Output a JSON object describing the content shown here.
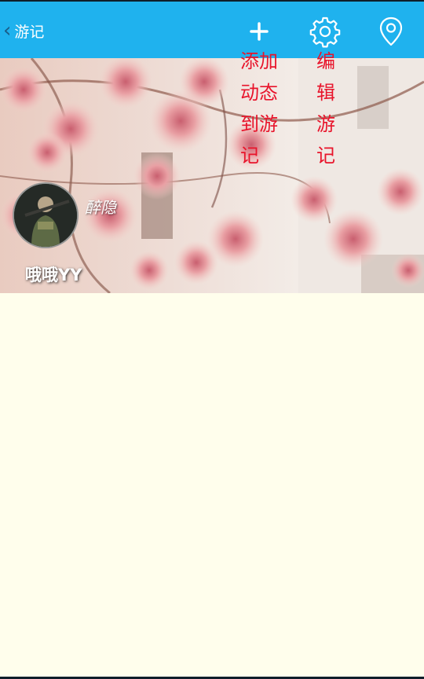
{
  "header": {
    "back_icon": "chevron-left-icon",
    "title": "游记",
    "add_icon": "plus-icon",
    "settings_icon": "gear-icon",
    "location_icon": "map-pin-icon",
    "bar_color": "#1fb2ee"
  },
  "tooltips": {
    "add_text": "添加动态到游记",
    "edit_text": "编辑游记",
    "color": "#e8142b"
  },
  "cover": {
    "username": "醉隐",
    "trip_name": "哦哦YY",
    "avatar_icon": "avatar-icon"
  },
  "page": {
    "background": "#fffeec"
  }
}
